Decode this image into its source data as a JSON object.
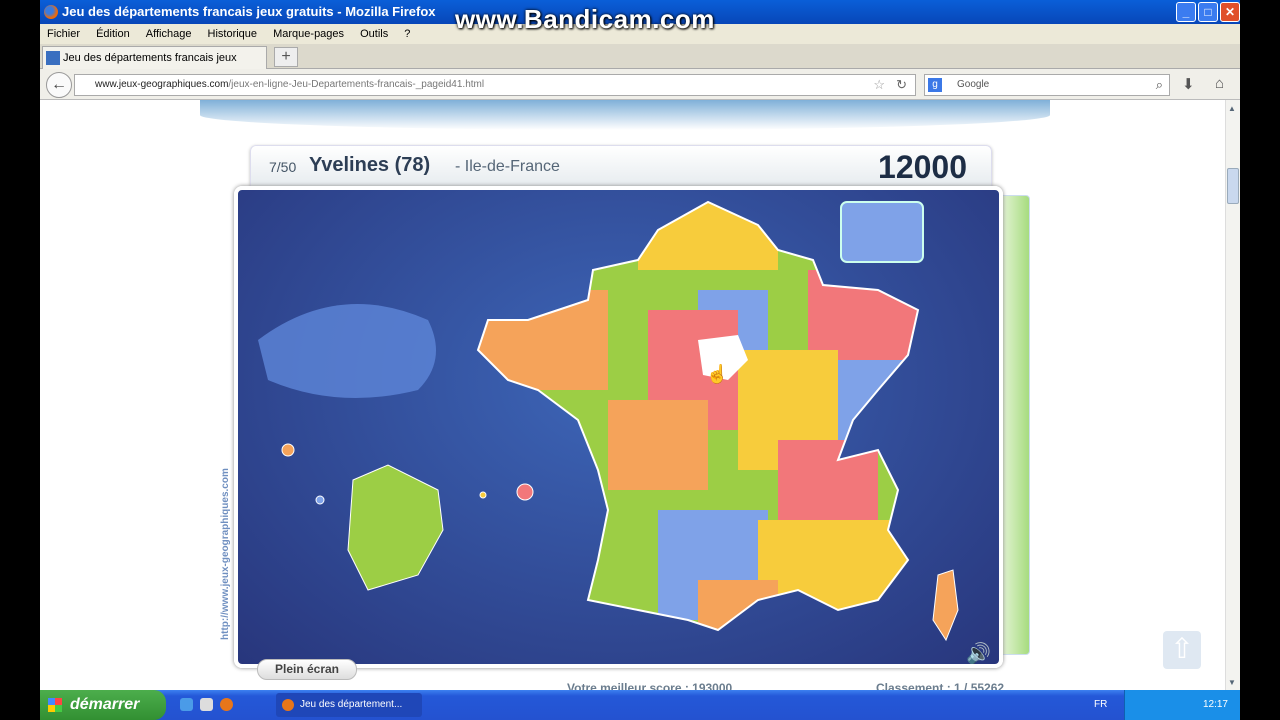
{
  "window": {
    "title": "Jeu des départements francais jeux gratuits - Mozilla Firefox",
    "watermark": "www.Bandicam.com",
    "minimize": "_",
    "maximize": "□",
    "close": "✕"
  },
  "menu": [
    "Fichier",
    "Édition",
    "Affichage",
    "Historique",
    "Marque-pages",
    "Outils",
    "?"
  ],
  "tab": {
    "label": "Jeu des départements francais jeux gratuits",
    "new_tab": "+"
  },
  "nav": {
    "url_domain": "www.jeux-geographiques.com",
    "url_path": "/jeux-en-ligne-Jeu-Departements-francais-_pageid41.html",
    "search_placeholder": "Google"
  },
  "game": {
    "progress": "7/50",
    "departement": "Yvelines (78)",
    "region": "- Ile-de-France",
    "score": "12000",
    "fullscreen_button": "Plein écran",
    "best_score": "Votre meilleur score : 193000",
    "ranking": "Classement : 1 / 55262",
    "site_link": "http://www.jeux-geographiques.com"
  },
  "colors": {
    "sea": "#2f4a9c",
    "yellow": "#f7cc3c",
    "orange": "#f5a35a",
    "green": "#9cce45",
    "blue": "#7fa2e8",
    "red": "#f2777a",
    "highlight": "#ffffff"
  },
  "taskbar": {
    "start": "démarrer",
    "task": "Jeu des département...",
    "lang": "FR",
    "clock": "12:17"
  }
}
